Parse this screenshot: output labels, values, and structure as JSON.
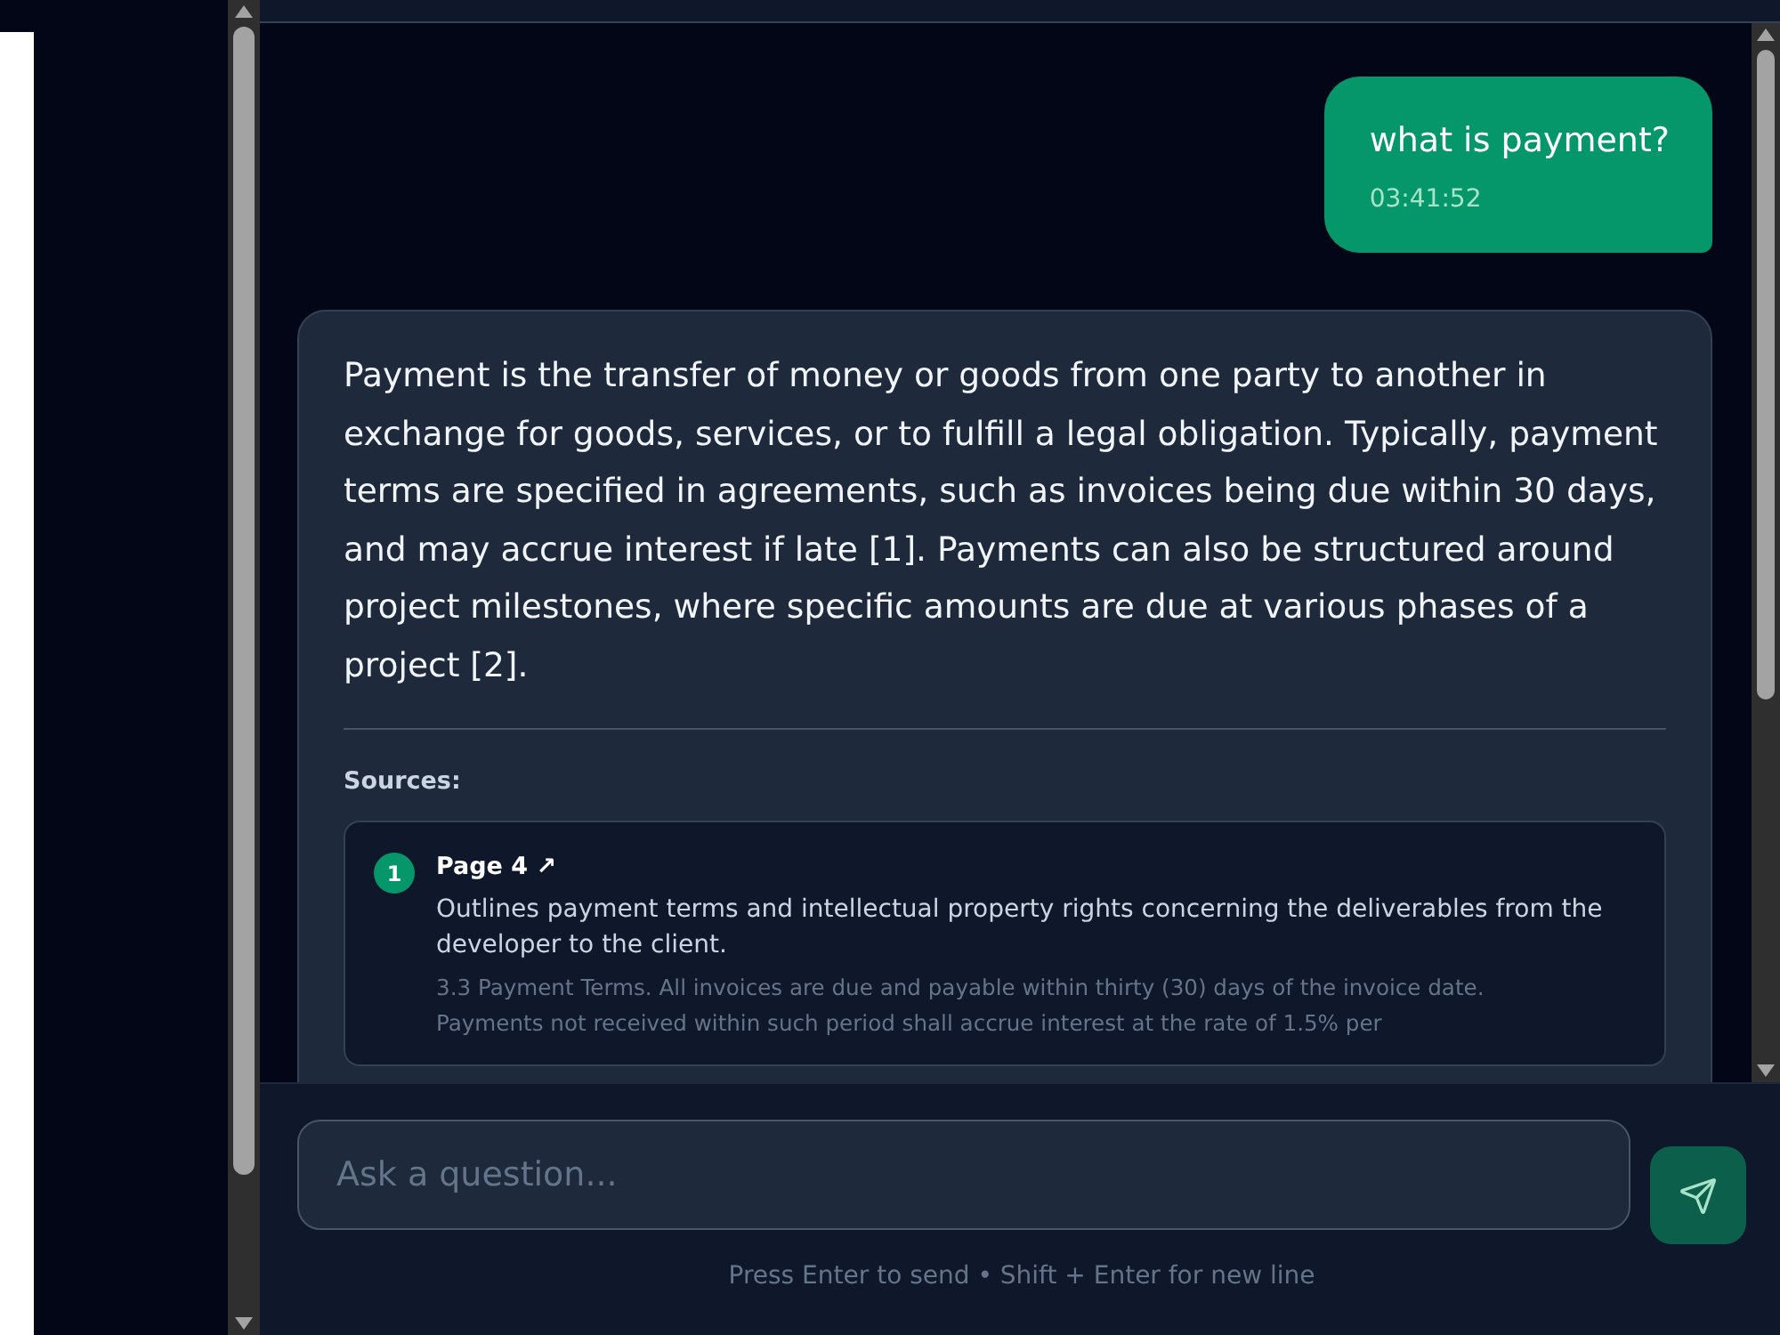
{
  "chat": {
    "messages": [
      {
        "kind": "user",
        "text": "what is payment?",
        "time": "03:41:52"
      },
      {
        "kind": "assistant",
        "text": "Payment is the transfer of money or goods from one party to another in exchange for goods, services, or to fulfill a legal obligation. Typically, payment terms are specified in agreements, such as invoices being due within 30 days, and may accrue interest if late [1]. Payments can also be structured around project milestones, where specific amounts are due at various phases of a project [2].",
        "sources_label": "Sources:",
        "sources": [
          {
            "number": "1",
            "title": "Page 4 ↗",
            "summary": "Outlines payment terms and intellectual property rights concerning the deliverables from the developer to the client.",
            "excerpt": "3.3 Payment Terms. All invoices are due and payable within thirty (30) days of the invoice date. Payments not received within such period shall accrue interest at the rate of 1.5% per"
          }
        ]
      }
    ]
  },
  "composer": {
    "placeholder": "Ask a question...",
    "hint": "Press Enter to send • Shift + Enter for new line"
  }
}
